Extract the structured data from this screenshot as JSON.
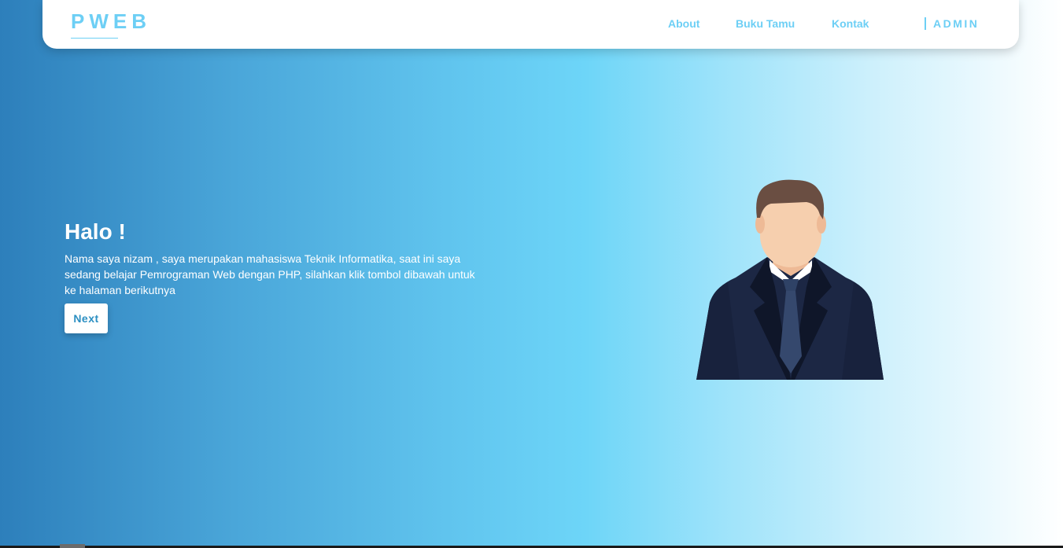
{
  "navbar": {
    "brand": "PWEB",
    "links": [
      "About",
      "Buku Tamu",
      "Kontak"
    ],
    "admin": "ADMIN"
  },
  "hero": {
    "title": "Halo !",
    "text": "Nama saya nizam , saya merupakan mahasiswa Teknik Informatika, saat ini saya sedang belajar Pemrograman Web dengan PHP, silahkan klik tombol dibawah untuk ke halaman berikutnya",
    "button_label": "Next",
    "illustration": "businessman-avatar-icon"
  },
  "colors": {
    "accent": "#6dcff5",
    "button_text": "#2c8fc2",
    "gradient_start": "#2d7fbb",
    "gradient_mid": "#6dd5f8",
    "gradient_end": "#ffffff"
  }
}
